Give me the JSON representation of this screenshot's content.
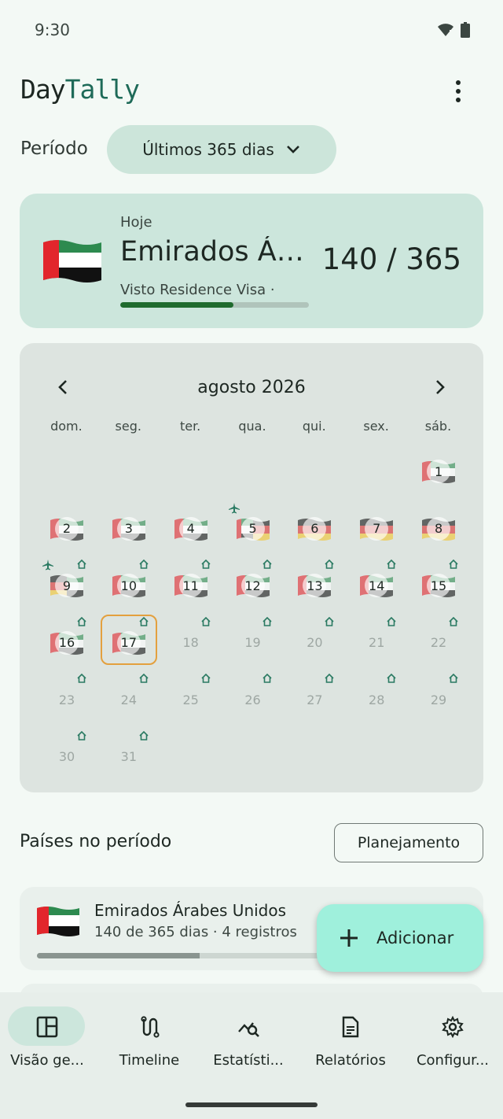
{
  "status_bar": {
    "time": "9:30",
    "icons": [
      "wifi-icon",
      "battery-icon"
    ]
  },
  "app": {
    "title_part1": "Day",
    "title_part2": "Tally",
    "menu_icon": "more-vert-icon"
  },
  "period": {
    "label": "Período",
    "selected": "Últimos 365 dias"
  },
  "today": {
    "label": "Hoje",
    "country": "Emirados Árabes Unidos",
    "visa": "Visto Residence Visa ·",
    "count": "140 / 365",
    "progress": 0.6,
    "flag": "uae-flag"
  },
  "calendar": {
    "month": "agosto 2026",
    "weekdays": [
      "dom.",
      "seg.",
      "ter.",
      "qua.",
      "qui.",
      "sex.",
      "sáb."
    ],
    "days": [
      {
        "n": "1",
        "f": "uae"
      },
      {
        "n": "2",
        "f": "uae"
      },
      {
        "n": "3",
        "f": "uae"
      },
      {
        "n": "4",
        "f": "uae"
      },
      {
        "n": "5",
        "f": "uae-de",
        "plane": true
      },
      {
        "n": "6",
        "f": "de"
      },
      {
        "n": "7",
        "f": "de"
      },
      {
        "n": "8",
        "f": "de"
      },
      {
        "n": "9",
        "f": "de-uae",
        "plane": true,
        "home": true
      },
      {
        "n": "10",
        "f": "uae",
        "home": true
      },
      {
        "n": "11",
        "f": "uae",
        "home": true
      },
      {
        "n": "12",
        "f": "uae",
        "home": true
      },
      {
        "n": "13",
        "f": "uae",
        "home": true
      },
      {
        "n": "14",
        "f": "uae",
        "home": true
      },
      {
        "n": "15",
        "f": "uae",
        "home": true
      },
      {
        "n": "16",
        "f": "uae",
        "home": true
      },
      {
        "n": "17",
        "f": "uae",
        "home": true,
        "today": true
      },
      {
        "n": "18",
        "home": true
      },
      {
        "n": "19",
        "home": true
      },
      {
        "n": "20",
        "home": true
      },
      {
        "n": "21",
        "home": true
      },
      {
        "n": "22",
        "home": true
      },
      {
        "n": "23",
        "home": true
      },
      {
        "n": "24",
        "home": true
      },
      {
        "n": "25",
        "home": true
      },
      {
        "n": "26",
        "home": true
      },
      {
        "n": "27",
        "home": true
      },
      {
        "n": "28",
        "home": true
      },
      {
        "n": "29",
        "home": true
      },
      {
        "n": "30",
        "home": true
      },
      {
        "n": "31",
        "home": true
      }
    ]
  },
  "countries_section": {
    "title": "Países no período",
    "plan_button": "Planejamento"
  },
  "countries": [
    {
      "name": "Emirados Árabes Unidos",
      "meta": "140 de 365 dias  ·  4 registros",
      "progress": 0.38
    }
  ],
  "fab": {
    "label": "Adicionar",
    "icon": "plus-icon"
  },
  "nav": [
    {
      "label": "Visão ge...",
      "icon": "dashboard-icon",
      "active": true
    },
    {
      "label": "Timeline",
      "icon": "route-icon"
    },
    {
      "label": "Estatísti...",
      "icon": "analytics-icon"
    },
    {
      "label": "Relatórios",
      "icon": "document-icon"
    },
    {
      "label": "Configur...",
      "icon": "gear-icon"
    }
  ],
  "colors": {
    "accent": "#1e6a58",
    "surface": "#cce6dc",
    "fab": "#9ff0dc",
    "today_outline": "#e3a03e"
  }
}
